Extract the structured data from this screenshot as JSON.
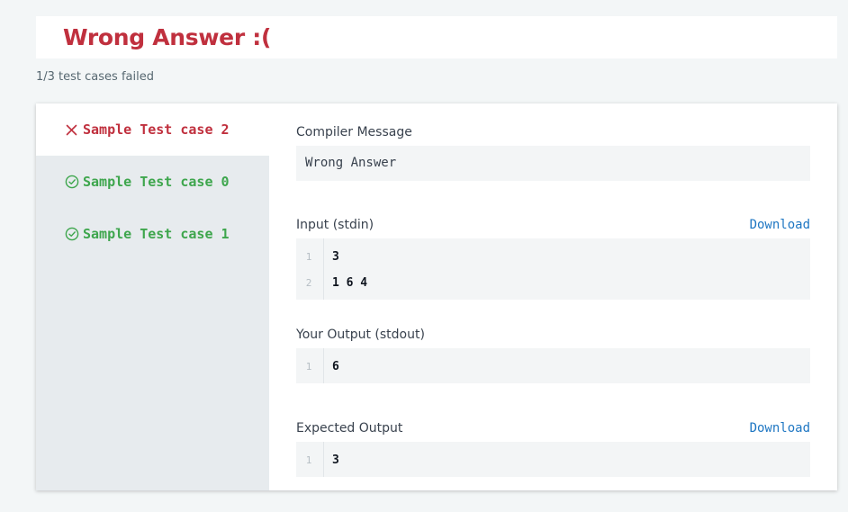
{
  "header": {
    "title": "Wrong Answer :(",
    "summary": "1/3 test cases failed"
  },
  "colors": {
    "failed": "#c0303e",
    "passed": "#3ea64d",
    "link": "#1f77c3"
  },
  "tabs": [
    {
      "label": "Sample Test case 2",
      "status": "failed",
      "icon": "x-icon",
      "active": true
    },
    {
      "label": "Sample Test case 0",
      "status": "passed",
      "icon": "check-circle-icon",
      "active": false
    },
    {
      "label": "Sample Test case 1",
      "status": "passed",
      "icon": "check-circle-icon",
      "active": false
    }
  ],
  "compiler": {
    "label": "Compiler Message",
    "message": "Wrong Answer"
  },
  "input": {
    "label": "Input (stdin)",
    "download_label": "Download",
    "lines": [
      {
        "no": "1",
        "text": "3"
      },
      {
        "no": "2",
        "text": "1 6 4"
      }
    ]
  },
  "your_output": {
    "label": "Your Output (stdout)",
    "lines": [
      {
        "no": "1",
        "text": "6"
      }
    ]
  },
  "expected_output": {
    "label": "Expected Output",
    "download_label": "Download",
    "lines": [
      {
        "no": "1",
        "text": "3"
      }
    ]
  }
}
